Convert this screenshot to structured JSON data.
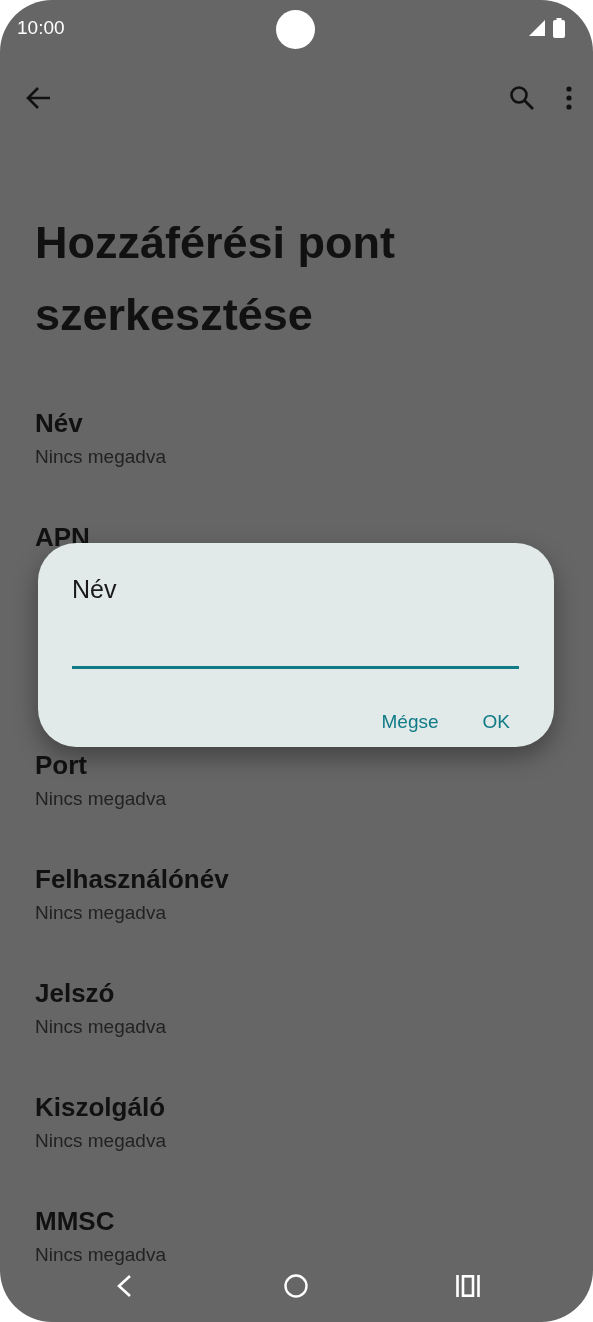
{
  "status_bar": {
    "time": "10:00"
  },
  "title": "Hozzáférési pont szerkesztése",
  "settings_top": [
    {
      "title": "Név",
      "subtitle": "Nincs megadva"
    },
    {
      "title": "APN"
    }
  ],
  "settings_bottom": [
    {
      "title": "Port",
      "subtitle": "Nincs megadva"
    },
    {
      "title": "Felhasználónév",
      "subtitle": "Nincs megadva"
    },
    {
      "title": "Jelszó",
      "subtitle": "Nincs megadva"
    },
    {
      "title": "Kiszolgáló",
      "subtitle": "Nincs megadva"
    },
    {
      "title": "MMSC",
      "subtitle": "Nincs megadva"
    }
  ],
  "dialog": {
    "title": "Név",
    "buttons": [
      "Mégse",
      "OK"
    ]
  }
}
